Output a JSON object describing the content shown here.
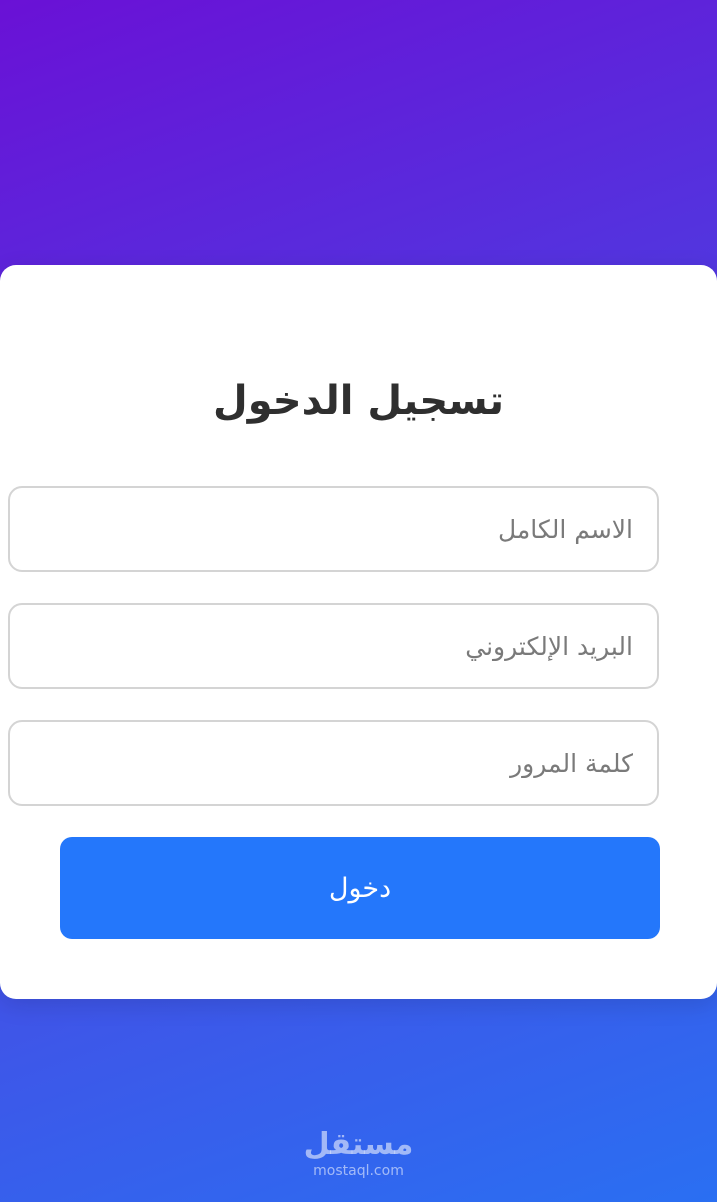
{
  "login": {
    "title": "تسجيل الدخول",
    "fields": {
      "full_name": {
        "placeholder": "الاسم الكامل",
        "value": ""
      },
      "email": {
        "placeholder": "البريد الإلكتروني",
        "value": ""
      },
      "password": {
        "placeholder": "كلمة المرور",
        "value": ""
      }
    },
    "submit_label": "دخول"
  },
  "watermark": {
    "logo_text": "مستقل",
    "url": "mostaql.com"
  },
  "colors": {
    "gradient_start": "#6a11d6",
    "gradient_end": "#2a6ff2",
    "button": "#2477fb",
    "card": "#ffffff"
  }
}
